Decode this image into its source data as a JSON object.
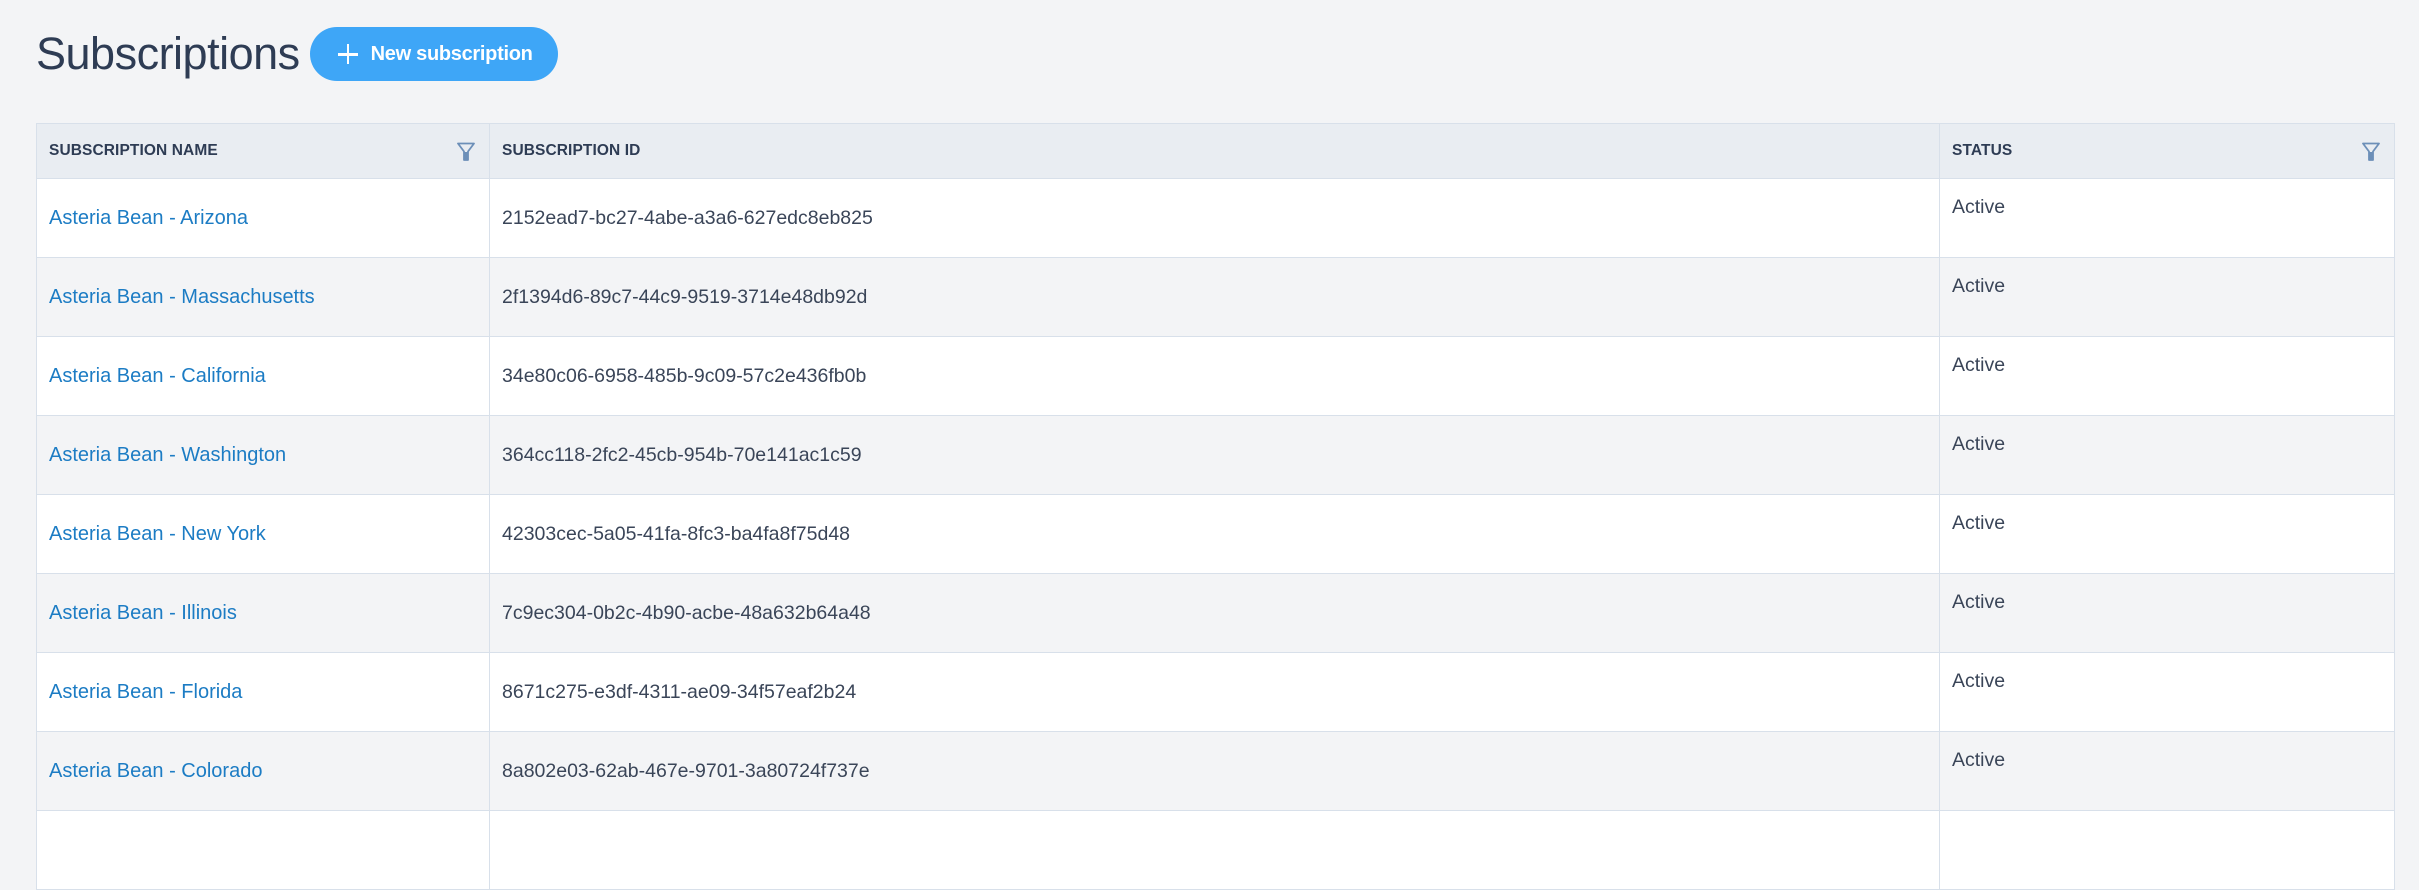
{
  "page": {
    "title": "Subscriptions",
    "new_button_label": "New subscription",
    "new_button_icon": "plus-icon",
    "accent_color": "#3ea6f7",
    "link_color": "#1c7cc4"
  },
  "table": {
    "columns": [
      {
        "label": "SUBSCRIPTION NAME",
        "filter_icon": "filter-icon"
      },
      {
        "label": "SUBSCRIPTION ID"
      },
      {
        "label": "STATUS",
        "filter_icon": "filter-icon"
      }
    ],
    "rows": [
      {
        "name": "Asteria Bean - Arizona",
        "id": "2152ead7-bc27-4abe-a3a6-627edc8eb825",
        "status": "Active"
      },
      {
        "name": "Asteria Bean - Massachusetts",
        "id": "2f1394d6-89c7-44c9-9519-3714e48db92d",
        "status": "Active"
      },
      {
        "name": "Asteria Bean - California",
        "id": "34e80c06-6958-485b-9c09-57c2e436fb0b",
        "status": "Active"
      },
      {
        "name": "Asteria Bean - Washington",
        "id": "364cc118-2fc2-45cb-954b-70e141ac1c59",
        "status": "Active"
      },
      {
        "name": "Asteria Bean - New York",
        "id": "42303cec-5a05-41fa-8fc3-ba4fa8f75d48",
        "status": "Active"
      },
      {
        "name": "Asteria Bean - Illinois",
        "id": "7c9ec304-0b2c-4b90-acbe-48a632b64a48",
        "status": "Active"
      },
      {
        "name": "Asteria Bean - Florida",
        "id": "8671c275-e3df-4311-ae09-34f57eaf2b24",
        "status": "Active"
      },
      {
        "name": "Asteria Bean - Colorado",
        "id": "8a802e03-62ab-467e-9701-3a80724f737e",
        "status": "Active"
      }
    ]
  }
}
